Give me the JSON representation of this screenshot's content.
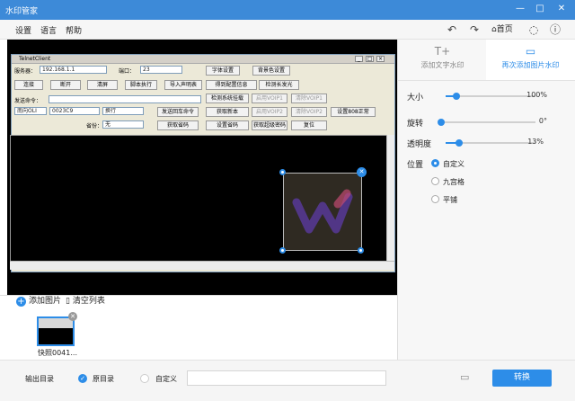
{
  "window": {
    "title": "水印管家",
    "minimize": "—",
    "maximize": "□",
    "close": "✕"
  },
  "menu": [
    "设置",
    "语言",
    "帮助"
  ],
  "header": {
    "home_label": "首页",
    "undo": "↶",
    "redo": "↷",
    "chat": "◌",
    "help": "ⓘ"
  },
  "telnet": {
    "title": "TelnetClient",
    "server_label": "服务器：",
    "server_value": "192.168.1.1",
    "port_label": "端口：",
    "port_value": "23",
    "font_btn": "字体设置",
    "bg_btn": "背景色设置",
    "connect_btn": "连接",
    "open_btn": "断开",
    "clear_btn": "清屏",
    "script_btn": "脚本执行",
    "import_btn": "导入声明表",
    "config_btn": "得到配置信息",
    "detect_btn": "检测长发光",
    "send_label": "发送命令：",
    "channel_value": "南向OLI",
    "hex_value": "0023C9",
    "newline_value": "换行",
    "sendcmd_btn": "发送回车命令",
    "province_label": "省份：",
    "province_value": "无",
    "detect_sys_btn": "检测系统挂载",
    "voip1_btn": "启用VOIP1",
    "voip1b_btn": "清除VOIP1",
    "getver_btn": "获取新本",
    "voip2_btn": "启用VOIP2",
    "voip2b_btn": "清除VOIP2",
    "set808_btn": "设置808正常",
    "getcode_btn": "获取省码",
    "setcode_btn": "设置省码",
    "getpwd_btn": "获取超级密码",
    "reset_btn": "复位"
  },
  "thumbs": {
    "add": "添加图片",
    "clear": "清空列表",
    "items": [
      {
        "name": "快照0041..."
      }
    ]
  },
  "tabs": [
    {
      "label": "添加文字水印",
      "icon": "T+"
    },
    {
      "label": "再次添加图片水印",
      "icon": "▭"
    }
  ],
  "settings": {
    "size_label": "大小",
    "size_value": "100%",
    "size_level": 0.1,
    "rotate_label": "旋转",
    "rotate_value": "0°",
    "rotate_level": 0.0,
    "opacity_label": "透明度",
    "opacity_value": "13%",
    "opacity_level": 0.13,
    "position_label": "位置",
    "positions": [
      "自定义",
      "九宫格",
      "平铺"
    ],
    "selected_position": "自定义"
  },
  "output": {
    "label": "输出目录",
    "option1": "原目录",
    "option2": "自定义",
    "path": "",
    "convert": "转换"
  },
  "colors": {
    "accent": "#2d8de8",
    "titlebar": "#3d8ad8"
  }
}
